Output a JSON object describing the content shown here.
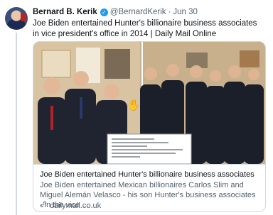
{
  "tweet": {
    "author_name": "Bernard B. Kerik",
    "handle": "@BernardKerik",
    "separator": "·",
    "time": "Jun 30",
    "text": "Joe Biden entertained Hunter's billionaire business associates in vice president's office in 2014 | Daily Mail Online"
  },
  "card": {
    "title": "Joe Biden entertained Hunter's billionaire business associates",
    "description": "Joe Biden entertained Mexican billionaires Carlos Slim and Miguel Alemán Velasco -  his son Hunter's business associates - in the vice ...",
    "domain": "dailymail.co.uk"
  },
  "icons": {
    "avatar": "profile-photo",
    "verified": "verified-badge-icon",
    "link": "link-icon"
  },
  "colors": {
    "verified_blue": "#1d9bf0",
    "secondary_text": "#536471",
    "border": "#cfd9de"
  }
}
